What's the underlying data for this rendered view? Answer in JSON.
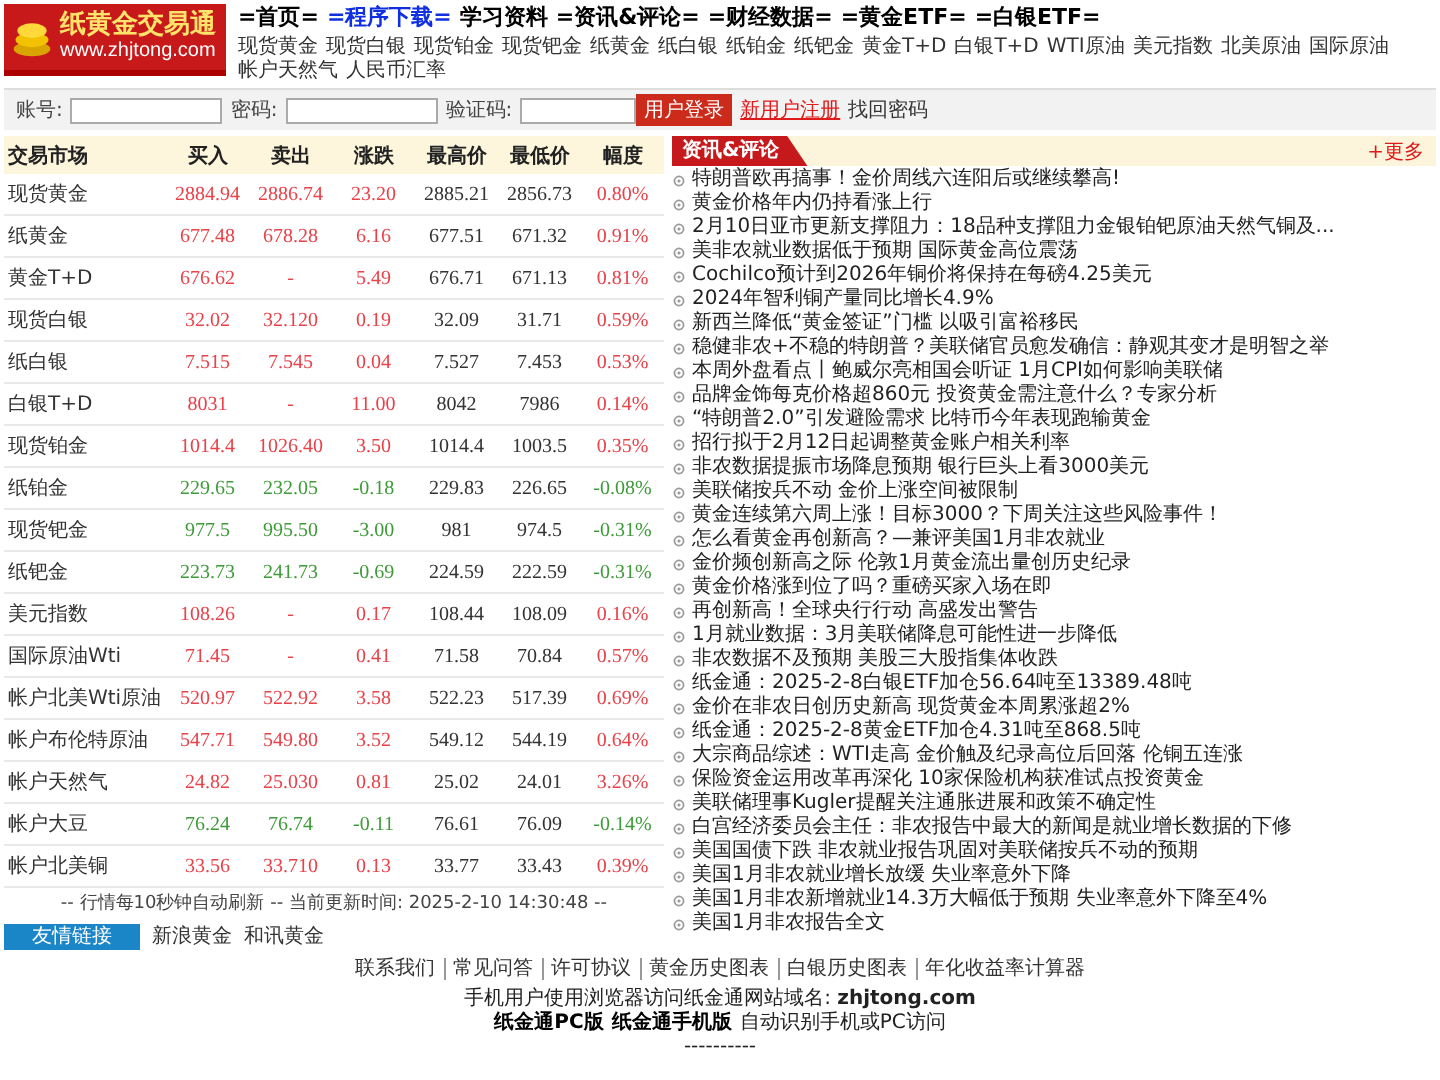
{
  "logo": {
    "title": "纸黄金交易通",
    "url": "www.zhjtong.com"
  },
  "nav": [
    {
      "label": "=首页=",
      "selected": false
    },
    {
      "label": "=程序下载=",
      "selected": true
    },
    {
      "label": "学习资料",
      "selected": false
    },
    {
      "label": "=资讯&评论=",
      "selected": false
    },
    {
      "label": "=财经数据=",
      "selected": false
    },
    {
      "label": "=黄金ETF=",
      "selected": false
    },
    {
      "label": "=白银ETF=",
      "selected": false
    }
  ],
  "subnav": [
    "现货黄金",
    "现货白银",
    "现货铂金",
    "现货钯金",
    "纸黄金",
    "纸白银",
    "纸铂金",
    "纸钯金",
    "黄金T+D",
    "白银T+D",
    "WTI原油",
    "美元指数",
    "北美原油",
    "国际原油",
    "帐户天然气",
    "人民币汇率"
  ],
  "login": {
    "account_label": "账号:",
    "password_label": "密码:",
    "captcha_label": "验证码:",
    "login_button": "用户登录",
    "register_link": "新用户注册",
    "recover_link": "找回密码"
  },
  "table": {
    "columns": [
      "交易市场",
      "买入",
      "卖出",
      "涨跌",
      "最高价",
      "最低价",
      "幅度"
    ],
    "rows": [
      {
        "cells": [
          "现货黄金",
          "2884.94",
          "2886.74",
          "23.20",
          "2885.21",
          "2856.73",
          "0.80%"
        ],
        "color": "#e8424a"
      },
      {
        "cells": [
          "纸黄金",
          "677.48",
          "678.28",
          "6.16",
          "677.51",
          "671.32",
          "0.91%"
        ],
        "color": "#e8424a"
      },
      {
        "cells": [
          "黄金T+D",
          "676.62",
          "-",
          "5.49",
          "676.71",
          "671.13",
          "0.81%"
        ],
        "color": "#e8424a"
      },
      {
        "cells": [
          "现货白银",
          "32.02",
          "32.120",
          "0.19",
          "32.09",
          "31.71",
          "0.59%"
        ],
        "color": "#e8424a"
      },
      {
        "cells": [
          "纸白银",
          "7.515",
          "7.545",
          "0.04",
          "7.527",
          "7.453",
          "0.53%"
        ],
        "color": "#e8424a"
      },
      {
        "cells": [
          "白银T+D",
          "8031",
          "-",
          "11.00",
          "8042",
          "7986",
          "0.14%"
        ],
        "color": "#e8424a"
      },
      {
        "cells": [
          "现货铂金",
          "1014.4",
          "1026.40",
          "3.50",
          "1014.4",
          "1003.5",
          "0.35%"
        ],
        "color": "#e8424a"
      },
      {
        "cells": [
          "纸铂金",
          "229.65",
          "232.05",
          "-0.18",
          "229.83",
          "226.65",
          "-0.08%"
        ],
        "color": "#3f9a3a"
      },
      {
        "cells": [
          "现货钯金",
          "977.5",
          "995.50",
          "-3.00",
          "981",
          "974.5",
          "-0.31%"
        ],
        "color": "#3f9a3a"
      },
      {
        "cells": [
          "纸钯金",
          "223.73",
          "241.73",
          "-0.69",
          "224.59",
          "222.59",
          "-0.31%"
        ],
        "color": "#3f9a3a"
      },
      {
        "cells": [
          "美元指数",
          "108.26",
          "-",
          "0.17",
          "108.44",
          "108.09",
          "0.16%"
        ],
        "color": "#e8424a"
      },
      {
        "cells": [
          "国际原油Wti",
          "71.45",
          "-",
          "0.41",
          "71.58",
          "70.84",
          "0.57%"
        ],
        "color": "#e8424a"
      },
      {
        "cells": [
          "帐户北美Wti原油",
          "520.97",
          "522.92",
          "3.58",
          "522.23",
          "517.39",
          "0.69%"
        ],
        "color": "#e8424a"
      },
      {
        "cells": [
          "帐户布伦特原油",
          "547.71",
          "549.80",
          "3.52",
          "549.12",
          "544.19",
          "0.64%"
        ],
        "color": "#e8424a"
      },
      {
        "cells": [
          "帐户天然气",
          "24.82",
          "25.030",
          "0.81",
          "25.02",
          "24.01",
          "3.26%"
        ],
        "color": "#e8424a"
      },
      {
        "cells": [
          "帐户大豆",
          "76.24",
          "76.74",
          "-0.11",
          "76.61",
          "76.09",
          "-0.14%"
        ],
        "color": "#3f9a3a"
      },
      {
        "cells": [
          "帐户北美铜",
          "33.56",
          "33.710",
          "0.13",
          "33.77",
          "33.43",
          "0.39%"
        ],
        "color": "#e8424a"
      }
    ]
  },
  "refresh_note": "-- 行情每10秒钟自动刷新 -- 当前更新时间:  2025-2-10 14:30:48 --",
  "news": {
    "title": "资讯&评论",
    "more": "+更多",
    "items": [
      "特朗普欧再搞事！金价周线六连阳后或继续攀高!",
      "黄金价格年内仍持看涨上行",
      "2月10日亚市更新支撑阻力：18品种支撑阻力金银铂钯原油天然气铜及...",
      "美非农就业数据低于预期 国际黄金高位震荡",
      "Cochilco预计到2026年铜价将保持在每磅4.25美元",
      "2024年智利铜产量同比增长4.9%",
      "新西兰降低“黄金签证”门槛 以吸引富裕移民",
      "稳健非农+不稳的特朗普？美联储官员愈发确信：静观其变才是明智之举",
      "本周外盘看点丨鲍威尔亮相国会听证 1月CPI如何影响美联储",
      "品牌金饰每克价格超860元 投资黄金需注意什么？专家分析",
      "“特朗普2.0”引发避险需求 比特币今年表现跑输黄金",
      "招行拟于2月12日起调整黄金账户相关利率",
      "非农数据提振市场降息预期 银行巨头上看3000美元",
      "美联储按兵不动 金价上涨空间被限制",
      "黄金连续第六周上涨！目标3000？下周关注这些风险事件！",
      "怎么看黄金再创新高？—兼评美国1月非农就业",
      "金价频创新高之际 伦敦1月黄金流出量创历史纪录",
      "黄金价格涨到位了吗？重磅买家入场在即",
      "再创新高！全球央行行动 高盛发出警告",
      "1月就业数据：3月美联储降息可能性进一步降低",
      "非农数据不及预期 美股三大股指集体收跌",
      "纸金通：2025-2-8白银ETF加仓56.64吨至13389.48吨",
      "金价在非农日创历史新高 现货黄金本周累涨超2%",
      "纸金通：2025-2-8黄金ETF加仓4.31吨至868.5吨",
      "大宗商品综述：WTI走高 金价触及纪录高位后回落 伦铜五连涨",
      "保险资金运用改革再深化 10家保险机构获准试点投资黄金",
      "美联储理事Kugler提醒关注通胀进展和政策不确定性",
      "白宫经济委员会主任：非农报告中最大的新闻是就业增长数据的下修",
      "美国国债下跌 非农就业报告巩固对美联储按兵不动的预期",
      "美国1月非农就业增长放缓 失业率意外下降",
      "美国1月非农新增就业14.3万大幅低于预期 失业率意外下降至4%",
      "美国1月非农报告全文"
    ]
  },
  "friend_links": {
    "title": "友情链接",
    "links": [
      "新浪黄金",
      "和讯黄金"
    ]
  },
  "footer": {
    "links": [
      "联系我们",
      "常见问答",
      "许可协议",
      "黄金历史图表",
      "白银历史图表",
      "年化收益率计算器"
    ],
    "mobile_note": "手机用户使用浏览器访问纸金通网站域名: **zhjtong.com**",
    "pc_link": "纸金通PC版",
    "mobile_link": "纸金通手机版",
    "auto_note": "自动识别手机或PC访问",
    "dashes": "----------"
  }
}
